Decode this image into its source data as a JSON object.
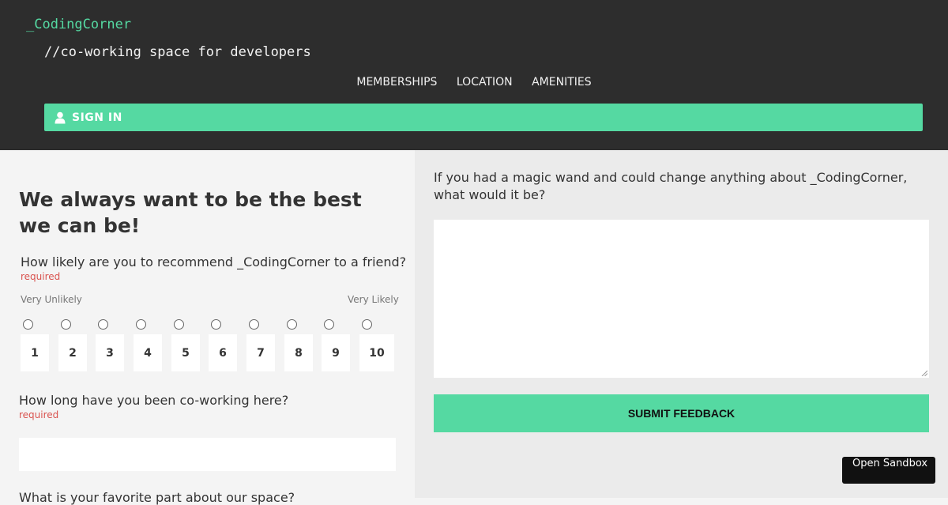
{
  "header": {
    "brand": "_CodingCorner",
    "tagline": "//co-working space for developers",
    "nav": [
      "MEMBERSHIPS",
      "LOCATION",
      "AMENITIES"
    ],
    "signin_label": "SIGN IN",
    "signin_icon": "user-icon"
  },
  "survey": {
    "heading": "We always want to be the best we can be!",
    "q1": "How likely are you to recommend _CodingCorner to a friend?",
    "q1_required": "required",
    "scale_low": "Very Unlikely",
    "scale_high": "Very Likely",
    "scale": [
      "1",
      "2",
      "3",
      "4",
      "5",
      "6",
      "7",
      "8",
      "9",
      "10"
    ],
    "q2": "How long have you been co-working here?",
    "q2_required": "required",
    "q2_value": "",
    "q3": "What is your favorite part about our space?"
  },
  "feedback": {
    "magic_question": "If you had a magic wand and could change anything about _CodingCorner, what would it be?",
    "textarea_value": "",
    "submit_label": "SUBMIT FEEDBACK"
  },
  "sandbox": {
    "label": "Open Sandbox"
  },
  "colors": {
    "accent": "#55d9a2",
    "header_bg": "#2d2d2d",
    "required": "#d9534f"
  }
}
